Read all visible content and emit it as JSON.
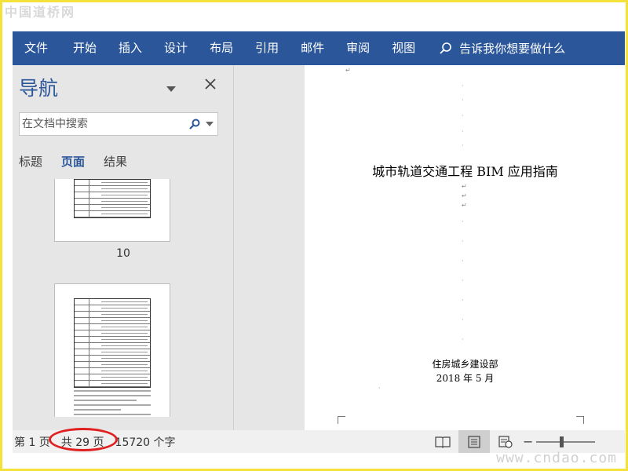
{
  "watermarks": {
    "top": "中国道桥网",
    "bottom": "www.cndao.com"
  },
  "ribbon": {
    "tabs": [
      "文件",
      "开始",
      "插入",
      "设计",
      "布局",
      "引用",
      "邮件",
      "审阅",
      "视图"
    ],
    "tell_me": "告诉我你想要做什么",
    "color": "#2b579a"
  },
  "nav_pane": {
    "title": "导航",
    "search_placeholder": "在文档中搜索",
    "tabs": [
      "标题",
      "页面",
      "结果"
    ],
    "active_tab": "页面",
    "thumbnail_page_label": "10"
  },
  "document": {
    "title": "城市轨道交通工程 BIM 应用指南",
    "organization": "住房城乡建设部",
    "date": "2018 年 5 月"
  },
  "status_bar": {
    "page": "第 1 页",
    "total_pages": "共 29 页",
    "word_count": "15720 个字"
  },
  "highlight_color": "#e02020"
}
